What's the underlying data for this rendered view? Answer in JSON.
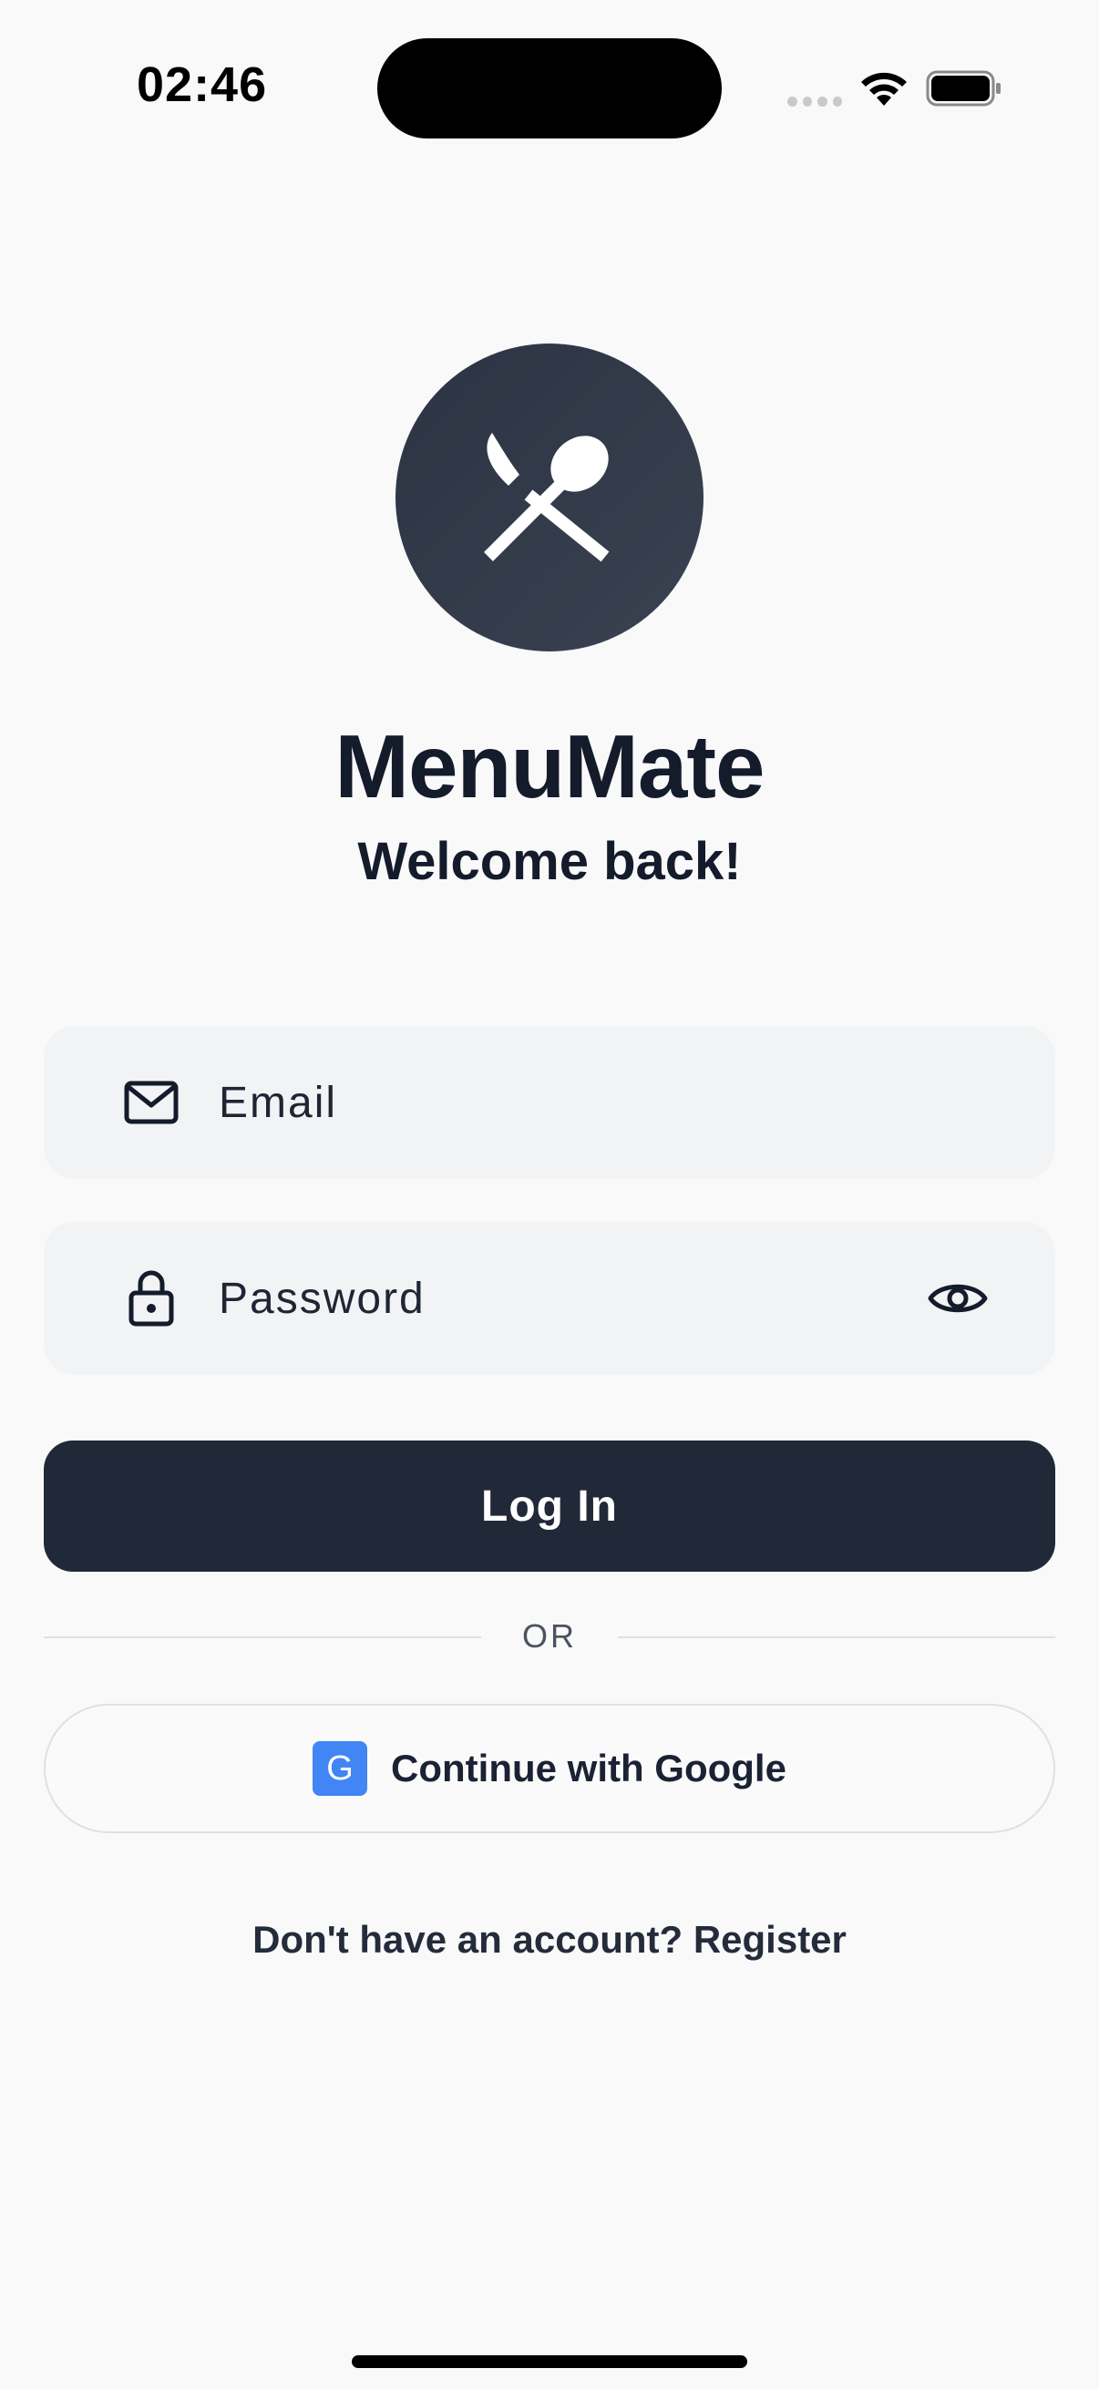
{
  "status_bar": {
    "time": "02:46"
  },
  "app": {
    "name": "MenuMate",
    "subtitle": "Welcome back!",
    "logo_icon": "fork-spoon-icon"
  },
  "form": {
    "email": {
      "placeholder": "Email",
      "value": "",
      "icon": "mail-icon"
    },
    "password": {
      "placeholder": "Password",
      "value": "",
      "icon": "lock-icon",
      "toggle_icon": "eye-icon"
    },
    "login_label": "Log In",
    "divider_label": "OR",
    "google": {
      "badge": "G",
      "label": "Continue with Google"
    },
    "register_prompt": "Don't have an account? Register"
  },
  "colors": {
    "background": "#f9f9f9",
    "primary": "#212938",
    "field_background": "#f2f3f5",
    "google_blue": "#4285f4"
  }
}
